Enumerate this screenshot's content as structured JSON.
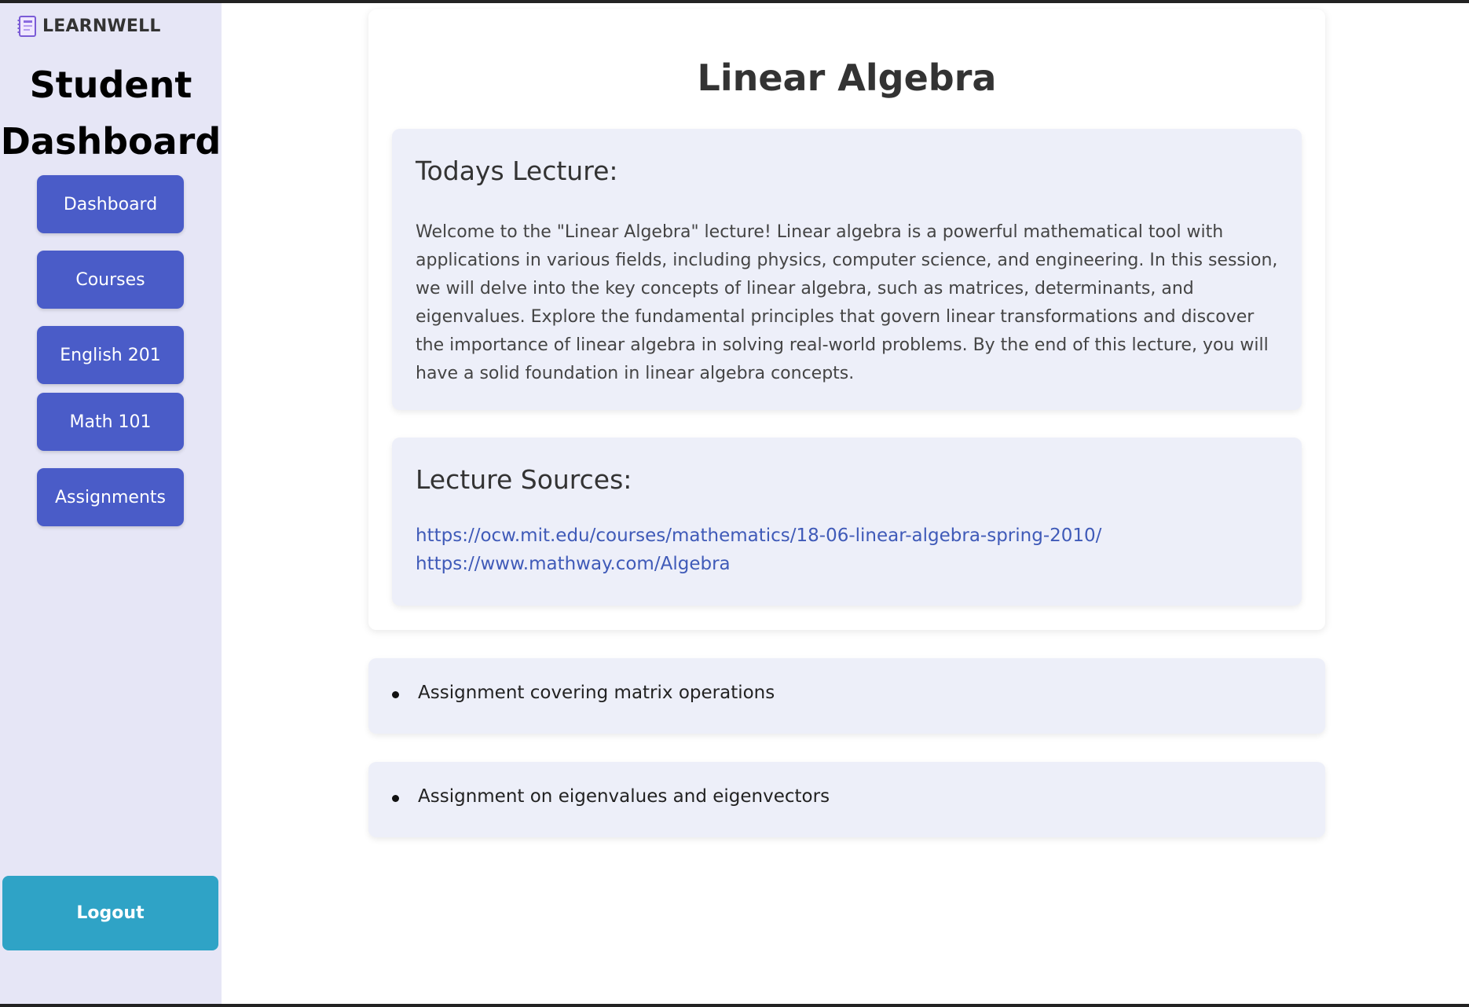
{
  "sidebar": {
    "brand": "LEARNWELL",
    "title_line1": "Student",
    "title_line2": "Dashboard",
    "nav": [
      {
        "label": "Dashboard"
      },
      {
        "label": "Courses"
      },
      {
        "label": "English 201"
      },
      {
        "label": "Math 101"
      },
      {
        "label": "Assignments"
      }
    ],
    "logout_label": "Logout"
  },
  "course": {
    "title": "Linear Algebra",
    "lecture_heading": "Todays Lecture:",
    "lecture_text": "Welcome to the \"Linear Algebra\" lecture! Linear algebra is a powerful mathematical tool with applications in various fields, including physics, computer science, and engineering. In this session, we will delve into the key concepts of linear algebra, such as matrices, determinants, and eigenvalues. Explore the fundamental principles that govern linear transformations and discover the importance of linear algebra in solving real-world problems. By the end of this lecture, you will have a solid foundation in linear algebra concepts.",
    "sources_heading": "Lecture Sources:",
    "sources": [
      "https://ocw.mit.edu/courses/mathematics/18-06-linear-algebra-spring-2010/",
      "https://www.mathway.com/Algebra"
    ]
  },
  "assignments": [
    {
      "text": "Assignment covering matrix operations"
    },
    {
      "text": "Assignment on eigenvalues and eigenvectors"
    }
  ],
  "colors": {
    "sidebar_bg": "#e6e6f6",
    "nav_button": "#4a5cc8",
    "logout_button": "#2fa3c6",
    "panel_bg": "#edeff9",
    "link": "#3f5ab8"
  },
  "icons": {
    "brand": "notebook-icon"
  }
}
